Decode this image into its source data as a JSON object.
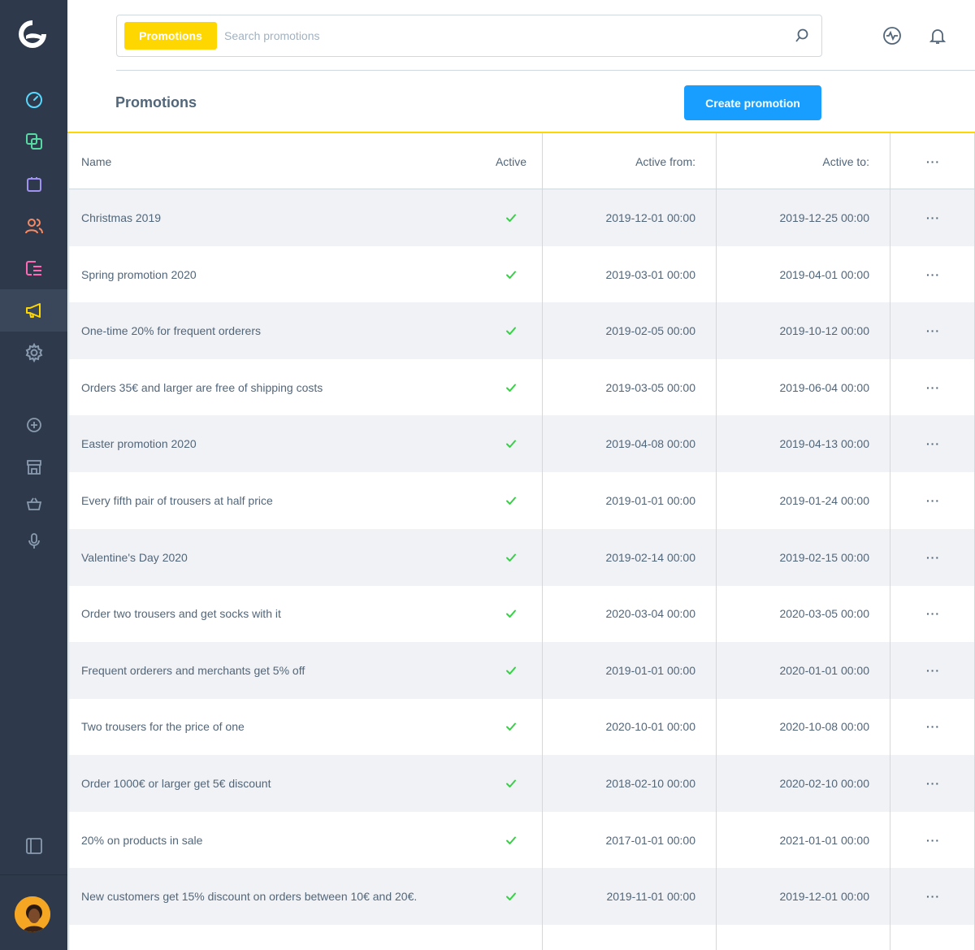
{
  "header": {
    "search_type": "Promotions",
    "search_placeholder": "Search promotions"
  },
  "page": {
    "title": "Promotions",
    "create_button": "Create promotion"
  },
  "colors": {
    "sidebar_bg": "#2e3a4b",
    "accent_yellow": "#ffd700",
    "primary_blue": "#189eff",
    "check_green": "#37d046"
  },
  "sidebar": {
    "icons": [
      "dashboard-icon",
      "catalogue-icon",
      "orders-icon",
      "customers-icon",
      "content-icon",
      "marketing-icon",
      "settings-icon",
      "add-icon",
      "storefront-icon",
      "basket-icon",
      "microphone-icon",
      "panel-toggle-icon"
    ]
  },
  "table": {
    "columns": {
      "name": "Name",
      "active": "Active",
      "from": "Active from:",
      "to": "Active to:",
      "more": "···"
    },
    "rows": [
      {
        "name": "Christmas 2019",
        "from": "2019-12-01 00:00",
        "to": "2019-12-25 00:00",
        "more": "···"
      },
      {
        "name": "Spring promotion 2020",
        "from": "2019-03-01 00:00",
        "to": "2019-04-01 00:00",
        "more": "···"
      },
      {
        "name": "One-time 20% for frequent orderers",
        "from": "2019-02-05 00:00",
        "to": "2019-10-12 00:00",
        "more": "···"
      },
      {
        "name": "Orders 35€ and larger are free of shipping costs",
        "from": "2019-03-05 00:00",
        "to": "2019-06-04 00:00",
        "more": "···"
      },
      {
        "name": "Easter promotion 2020",
        "from": "2019-04-08 00:00",
        "to": "2019-04-13 00:00",
        "more": "···"
      },
      {
        "name": "Every fifth pair of trousers at half price",
        "from": "2019-01-01 00:00",
        "to": "2019-01-24 00:00",
        "more": "···"
      },
      {
        "name": "Valentine's Day 2020",
        "from": "2019-02-14 00:00",
        "to": "2019-02-15 00:00",
        "more": "···"
      },
      {
        "name": "Order two trousers and get socks with it",
        "from": "2020-03-04 00:00",
        "to": "2020-03-05 00:00",
        "more": "···"
      },
      {
        "name": "Frequent orderers and merchants get 5% off",
        "from": "2019-01-01 00:00",
        "to": "2020-01-01 00:00",
        "more": "···"
      },
      {
        "name": "Two trousers for the price of one",
        "from": "2020-10-01 00:00",
        "to": "2020-10-08 00:00",
        "more": "···"
      },
      {
        "name": "Order 1000€ or larger get 5€ discount",
        "from": "2018-02-10 00:00",
        "to": "2020-02-10 00:00",
        "more": "···"
      },
      {
        "name": "20% on products in sale",
        "from": "2017-01-01 00:00",
        "to": "2021-01-01 00:00",
        "more": "···"
      },
      {
        "name": "New customers get 15% discount on orders between 10€ and 20€.",
        "from": "2019-11-01 00:00",
        "to": "2019-12-01 00:00",
        "more": "···"
      }
    ]
  }
}
